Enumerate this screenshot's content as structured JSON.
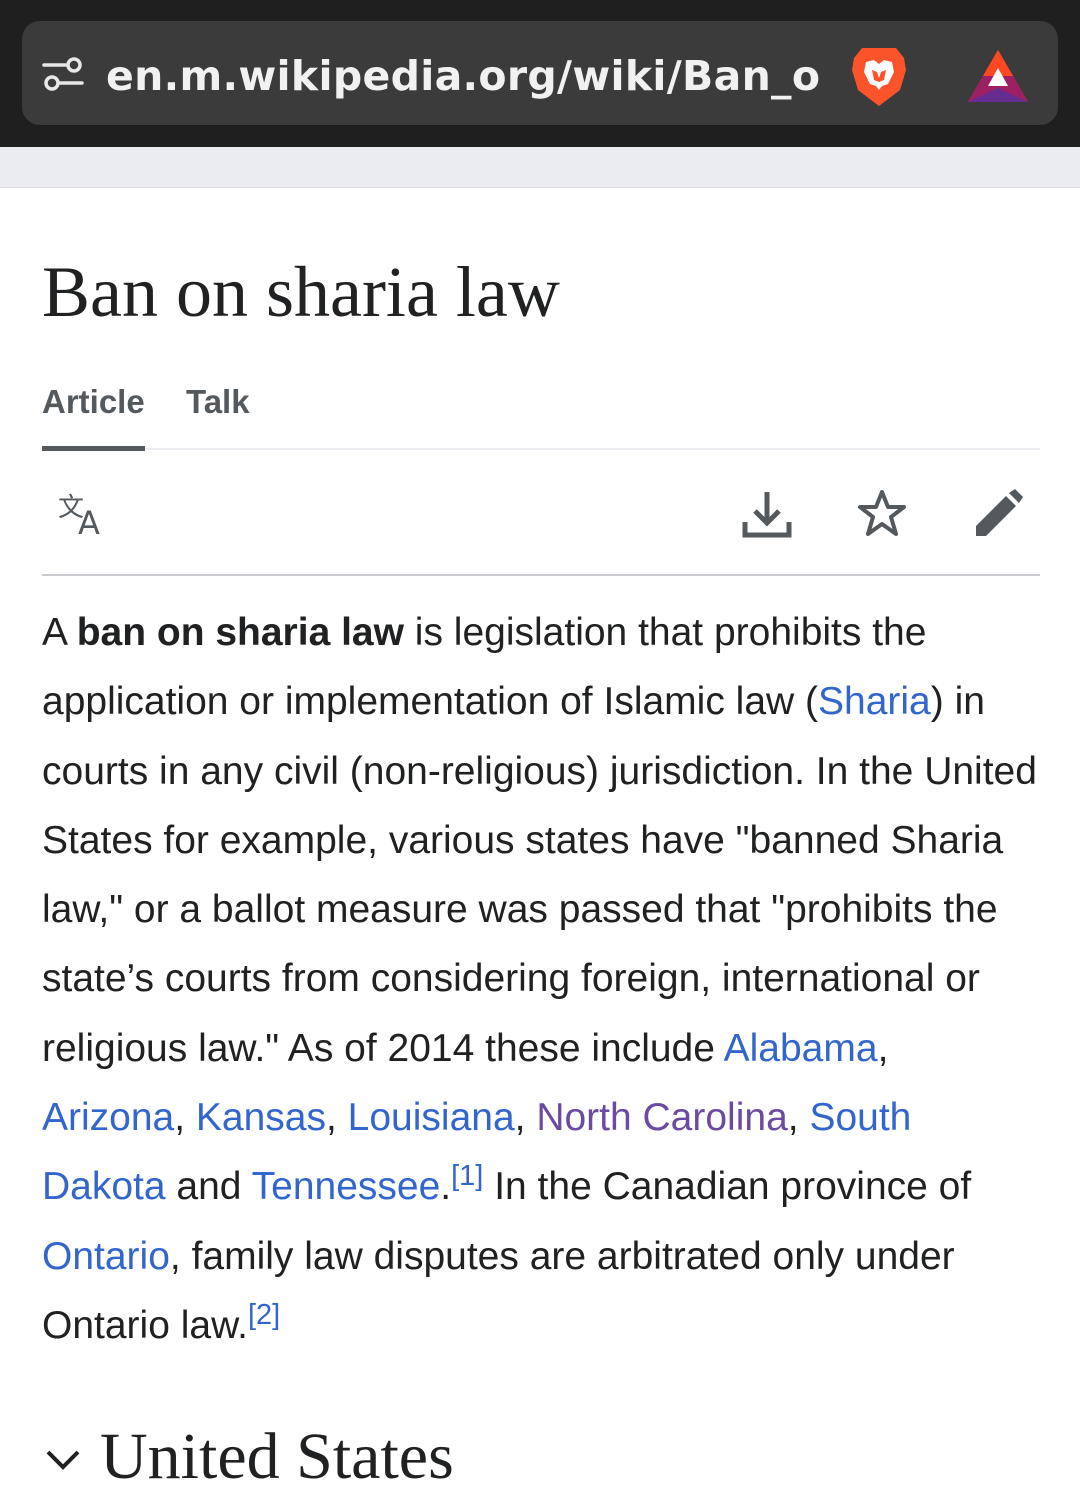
{
  "browser": {
    "url": "en.m.wikipedia.org/wiki/Ban_on_shar",
    "icons": [
      "tune-icon",
      "brave-lion-icon",
      "bat-rewards-icon"
    ]
  },
  "article": {
    "title": "Ban on sharia law",
    "tabs": [
      "Article",
      "Talk"
    ],
    "toolbar_icons": [
      "translate-icon",
      "download-icon",
      "star-icon",
      "edit-icon"
    ]
  },
  "intro": {
    "t1": "A ",
    "bold": "ban on sharia law",
    "t2": " is legislation that prohibits the application or implementation of Islamic law (",
    "link_sharia": "Sharia",
    "t3": ") in courts in any civil (non-religious) jurisdiction. In the United States for example, various states have \"banned Sharia law,\" or a ballot measure was passed that \"prohibits the state’s courts from considering foreign, international or religious law.\" As of 2014 these include ",
    "link_alabama": "Alabama",
    "sep1": ", ",
    "link_arizona": "Arizona",
    "sep2": ", ",
    "link_kansas": "Kansas",
    "sep3": ", ",
    "link_louisiana": "Louisiana",
    "sep4": ", ",
    "link_north_carolina": "North Carolina",
    "sep5": ", ",
    "link_south_dakota": "South Dakota",
    "t4": " and ",
    "link_tennessee": "Tennessee",
    "t5": ".",
    "ref1": "[1]",
    "t6": " In the Canadian province of ",
    "link_ontario": "Ontario",
    "t7": ", family law disputes are arbitrated only under Ontario law.",
    "ref2": "[2]"
  },
  "sections": [
    {
      "title": "United States"
    }
  ],
  "colors": {
    "link": "#3366cc",
    "visited_link": "#6b4ba1",
    "text": "#202122",
    "browser_bar": "#1f1f1f",
    "url_pill": "#3b3b3b"
  }
}
